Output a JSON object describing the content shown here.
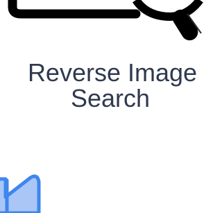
{
  "tile": {
    "title_line1": "Reverse Image",
    "title_line2": "Search"
  },
  "icons": {
    "search": "magnifying-glass-icon",
    "image": "image-icon"
  },
  "colors": {
    "title_text": "#2f3a4f",
    "icon_stroke": "#000000",
    "image_icon_fill": "#a9c6f7",
    "image_icon_stroke": "#3f86ef"
  }
}
